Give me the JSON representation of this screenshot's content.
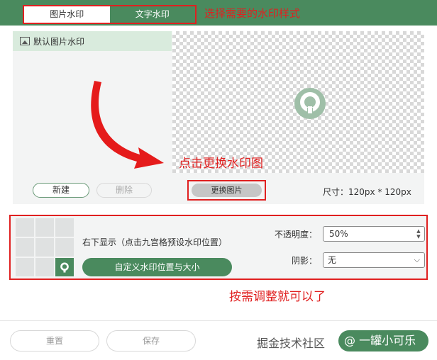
{
  "tabs": [
    {
      "label": "图片水印",
      "active": true
    },
    {
      "label": "文字水印",
      "active": false
    }
  ],
  "annotations": {
    "top": "选择需要的水印样式",
    "middle": "点击更换水印图",
    "bottom": "按需调整就可以了"
  },
  "library": {
    "selected_item": "默认图片水印",
    "new_label": "新建",
    "delete_label": "删除"
  },
  "preview": {
    "replace_label": "更换图片",
    "size_label": "尺寸：120px * 120px"
  },
  "position": {
    "description": "右下显示（点击九宫格预设水印位置）",
    "custom_button": "自定义水印位置与大小",
    "selected_cell": 8
  },
  "opacity": {
    "label": "不透明度：",
    "value": "50%"
  },
  "shadow": {
    "label": "阴影：",
    "value": "无"
  },
  "footer": {
    "reset_label": "重置",
    "save_label": "保存"
  },
  "watermark": {
    "text": "掘金技术社区",
    "pill": "@ 一罐小可乐"
  },
  "colors": {
    "brand": "#4a8a5e",
    "annotation": "#e02020"
  },
  "icons": [
    "image-icon",
    "watermark-logo-icon",
    "chevron-down-icon",
    "spin-up-icon",
    "spin-down-icon"
  ]
}
